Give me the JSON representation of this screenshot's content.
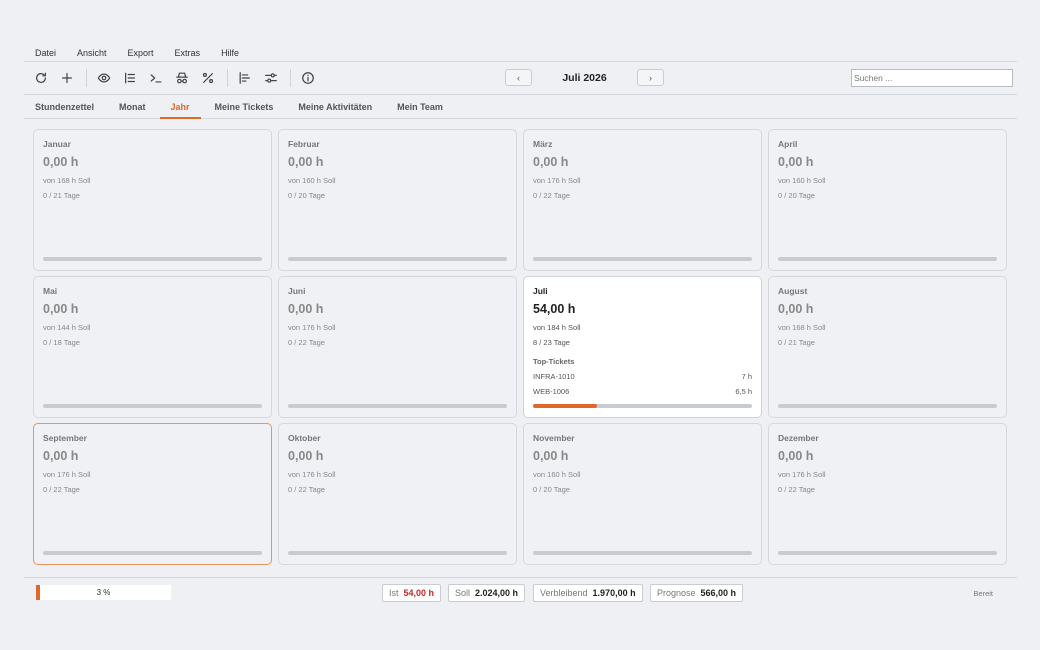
{
  "menu": [
    "Datei",
    "Ansicht",
    "Export",
    "Extras",
    "Hilfe"
  ],
  "toolbar": {
    "icons": [
      "refresh-icon",
      "plus-icon",
      "eye-icon",
      "list-icon",
      "terminal-icon",
      "incognito-icon",
      "percent-icon",
      "chart-align-icon",
      "sliders-icon",
      "info-icon"
    ],
    "prev_label": "‹",
    "next_label": "›",
    "period": "Juli 2026",
    "search_placeholder": "Suchen ..."
  },
  "tabs": [
    {
      "label": "Stundenzettel",
      "active": false
    },
    {
      "label": "Monat",
      "active": false
    },
    {
      "label": "Jahr",
      "active": true
    },
    {
      "label": "Meine Tickets",
      "active": false
    },
    {
      "label": "Meine Aktivitäten",
      "active": false
    },
    {
      "label": "Mein Team",
      "active": false
    }
  ],
  "months": [
    {
      "name": "Januar",
      "hours": "0,00 h",
      "soll": "von 168 h Soll",
      "days": "0 / 21 Tage",
      "progress": 0
    },
    {
      "name": "Februar",
      "hours": "0,00 h",
      "soll": "von 160 h Soll",
      "days": "0 / 20 Tage",
      "progress": 0
    },
    {
      "name": "März",
      "hours": "0,00 h",
      "soll": "von 176 h Soll",
      "days": "0 / 22 Tage",
      "progress": 0
    },
    {
      "name": "April",
      "hours": "0,00 h",
      "soll": "von 160 h Soll",
      "days": "0 / 20 Tage",
      "progress": 0
    },
    {
      "name": "Mai",
      "hours": "0,00 h",
      "soll": "von 144 h Soll",
      "days": "0 / 18 Tage",
      "progress": 0
    },
    {
      "name": "Juni",
      "hours": "0,00 h",
      "soll": "von 176 h Soll",
      "days": "0 / 22 Tage",
      "progress": 0
    },
    {
      "name": "Juli",
      "hours": "54,00 h",
      "soll": "von 184 h Soll",
      "days": "8 / 23 Tage",
      "progress": 0.29,
      "current": true,
      "top_label": "Top-Tickets",
      "tickets": [
        {
          "id": "INFRA-1010",
          "hours": "7 h"
        },
        {
          "id": "WEB-1006",
          "hours": "6,5 h"
        }
      ]
    },
    {
      "name": "August",
      "hours": "0,00 h",
      "soll": "von 168 h Soll",
      "days": "0 / 21 Tage",
      "progress": 0
    },
    {
      "name": "September",
      "hours": "0,00 h",
      "soll": "von 176 h Soll",
      "days": "0 / 22 Tage",
      "progress": 0,
      "selected": true
    },
    {
      "name": "Oktober",
      "hours": "0,00 h",
      "soll": "von 176 h Soll",
      "days": "0 / 22 Tage",
      "progress": 0
    },
    {
      "name": "November",
      "hours": "0,00 h",
      "soll": "von 160 h Soll",
      "days": "0 / 20 Tage",
      "progress": 0
    },
    {
      "name": "Dezember",
      "hours": "0,00 h",
      "soll": "von 176 h Soll",
      "days": "0 / 22 Tage",
      "progress": 0
    }
  ],
  "status": {
    "progress_percent": 3,
    "progress_text": "3 %",
    "ist_label": "Ist",
    "ist_value": "54,00 h",
    "soll_label": "Soll",
    "soll_value": "2.024,00 h",
    "rest_label": "Verbleibend",
    "rest_value": "1.970,00 h",
    "prog_label": "Prognose",
    "prog_value": "566,00 h",
    "state": "Bereit"
  },
  "colors": {
    "accent": "#e0692a",
    "ist_value": "#c62828"
  }
}
